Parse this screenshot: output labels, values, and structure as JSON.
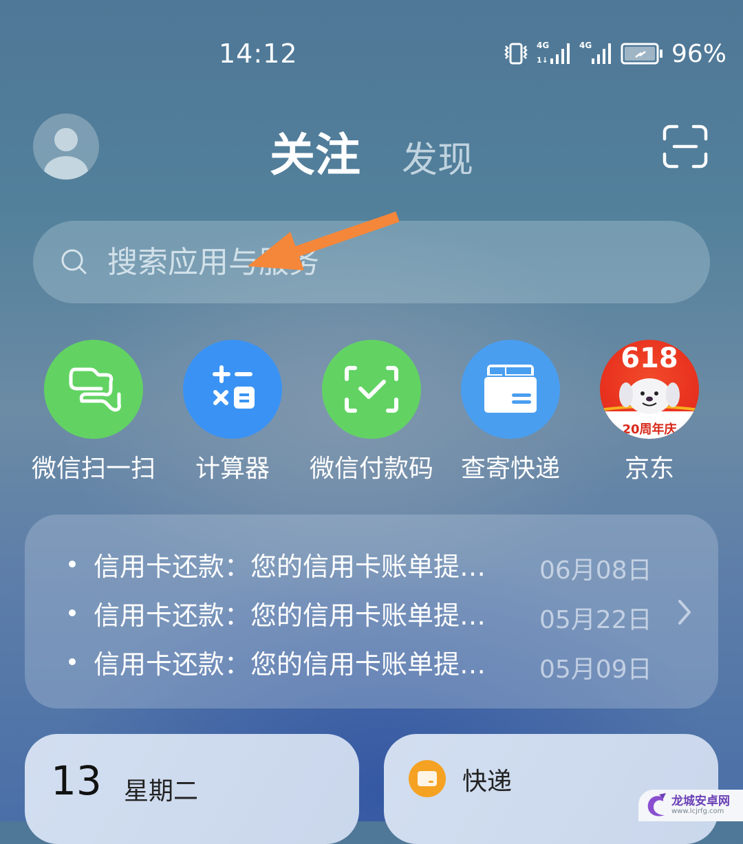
{
  "status_bar": {
    "time": "14:12",
    "icons": [
      "vibrate-icon",
      "signal-4g-sim1-icon",
      "signal-4g-sim2-icon",
      "battery-charging-icon"
    ],
    "sim1_label": "4G",
    "sim2_label": "4G",
    "battery_percent": "96%"
  },
  "header": {
    "avatar_icon": "user-avatar-icon",
    "tabs": [
      {
        "label": "关注",
        "active": true
      },
      {
        "label": "发现",
        "active": false
      }
    ],
    "scan_icon": "scan-icon"
  },
  "search": {
    "placeholder": "搜索应用与服务",
    "value": "",
    "icon": "search-icon"
  },
  "annotation": {
    "arrow_color": "#f5873a"
  },
  "shortcuts": [
    {
      "label": "微信扫一扫",
      "icon": "wechat-scan-icon",
      "color": "#62d363"
    },
    {
      "label": "计算器",
      "icon": "calculator-icon",
      "color": "#3a93f4"
    },
    {
      "label": "微信付款码",
      "icon": "wechat-pay-code-icon",
      "color": "#62d363"
    },
    {
      "label": "查寄快递",
      "icon": "package-box-icon",
      "color": "#4a9ef0"
    },
    {
      "label": "京东",
      "icon": "jd-618-icon",
      "badge_top": "618",
      "badge_bottom": "20周年庆",
      "color": "#e8321f"
    }
  ],
  "notices": [
    {
      "text": "信用卡还款：您的信用卡账单提…",
      "date": "06月08日"
    },
    {
      "text": "信用卡还款：您的信用卡账单提…",
      "date": "05月22日"
    },
    {
      "text": "信用卡还款：您的信用卡账单提…",
      "date": "05月09日"
    }
  ],
  "widgets": {
    "calendar": {
      "day": "13",
      "weekday": "星期二"
    },
    "express": {
      "label": "快递",
      "icon": "express-icon",
      "color": "#f5a223"
    }
  },
  "watermark": {
    "title": "龙城安卓网",
    "url": "www.lcjrfg.com"
  }
}
